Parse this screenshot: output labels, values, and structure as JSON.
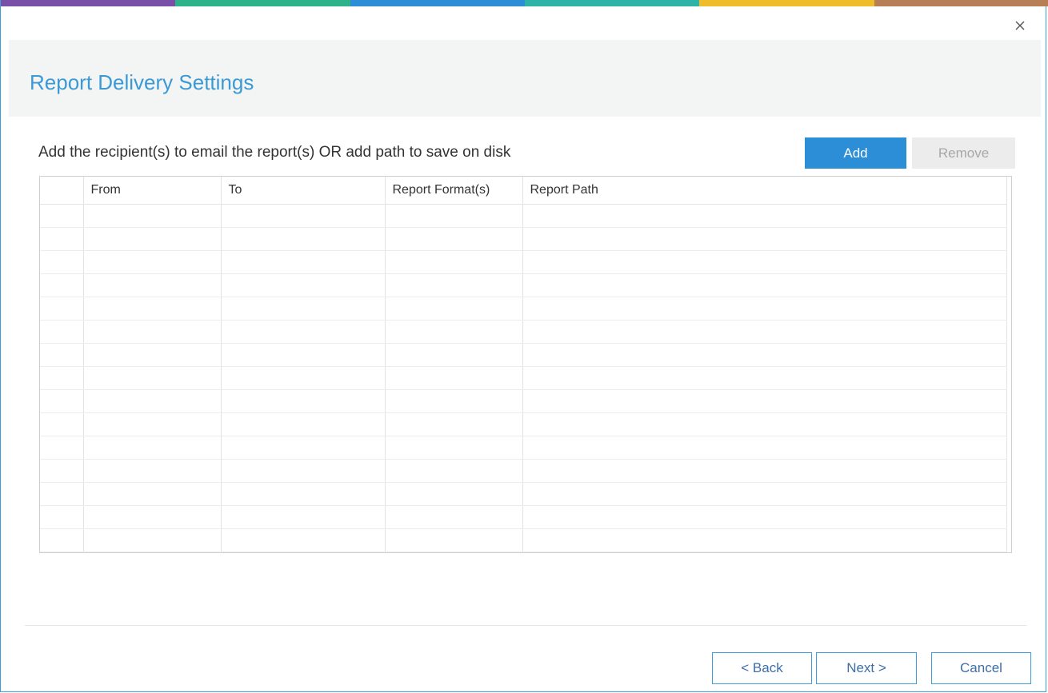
{
  "dialog": {
    "title": "Report Delivery Settings",
    "close_icon": "close-icon",
    "accent_colors": [
      "#7a4fa8",
      "#2db28a",
      "#2c8ed6",
      "#2fb3a6",
      "#efbd2b",
      "#b87e56"
    ]
  },
  "content": {
    "instruction": "Add the recipient(s) to email the report(s) OR add path to save on disk",
    "add_label": "Add",
    "remove_label": "Remove"
  },
  "grid": {
    "columns": [
      "",
      "From",
      "To",
      "Report Format(s)",
      "Report Path"
    ],
    "rows": []
  },
  "footer": {
    "back_label": "< Back",
    "next_label": "Next >",
    "cancel_label": "Cancel"
  },
  "colors": {
    "accent": "#2c8ed6",
    "title": "#3b9ad5"
  }
}
